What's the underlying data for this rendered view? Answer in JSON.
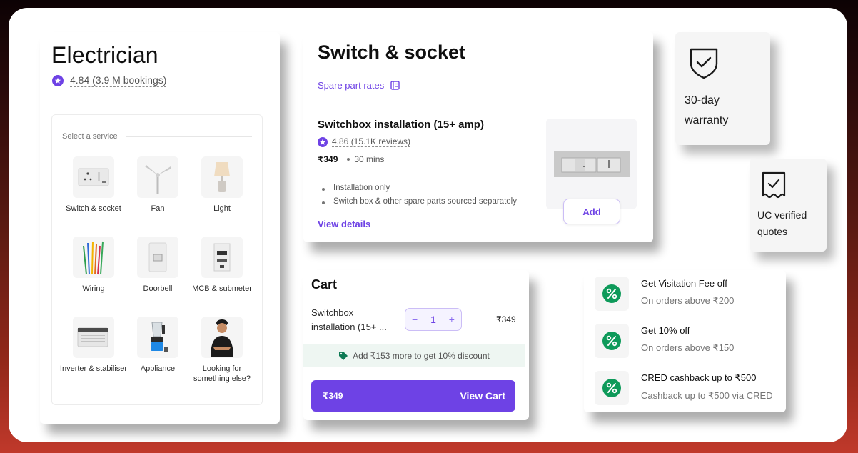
{
  "electrician": {
    "title": "Electrician",
    "rating": "4.84 (3.9 M bookings)",
    "select_label": "Select a service",
    "services": [
      {
        "label": "Switch & socket",
        "icon": "switch-socket-icon"
      },
      {
        "label": "Fan",
        "icon": "fan-icon"
      },
      {
        "label": "Light",
        "icon": "lamp-icon"
      },
      {
        "label": "Wiring",
        "icon": "wiring-icon"
      },
      {
        "label": "Doorbell",
        "icon": "doorbell-icon"
      },
      {
        "label": "MCB & submeter",
        "icon": "mcb-icon"
      },
      {
        "label": "Inverter & stabiliser",
        "icon": "inverter-icon"
      },
      {
        "label": "Appliance",
        "icon": "appliance-icon"
      },
      {
        "label": "Looking for something else?",
        "icon": "professional-icon"
      }
    ]
  },
  "switch_section": {
    "title": "Switch & socket",
    "spare_part_rates": "Spare part rates",
    "item": {
      "title": "Switchbox installation (15+ amp)",
      "rating": "4.86 (15.1K reviews)",
      "price": "₹349",
      "duration": "30 mins",
      "bullets": [
        "Installation only",
        "Switch box & other spare parts sourced separately"
      ],
      "view_details": "View details",
      "add_label": "Add"
    }
  },
  "features": {
    "warranty": "30-day warranty",
    "uc_verified": "UC verified quotes"
  },
  "cart": {
    "title": "Cart",
    "item_name": "Switchbox installation (15+ ...",
    "quantity": "1",
    "minus": "−",
    "plus": "+",
    "item_price": "₹349",
    "promo": "Add ₹153 more to get 10% discount",
    "total": "₹349",
    "view_cart": "View Cart"
  },
  "offers": [
    {
      "title": "Get Visitation Fee off",
      "subtitle": "On orders above ₹200"
    },
    {
      "title": "Get 10% off",
      "subtitle": "On orders above ₹150"
    },
    {
      "title": "CRED cashback up to ₹500",
      "subtitle": "Cashback up to ₹500 via CRED"
    }
  ],
  "colors": {
    "brand": "#6e42e5",
    "offer_green": "#0e9a5a",
    "promo_bg": "#eef6f2"
  }
}
